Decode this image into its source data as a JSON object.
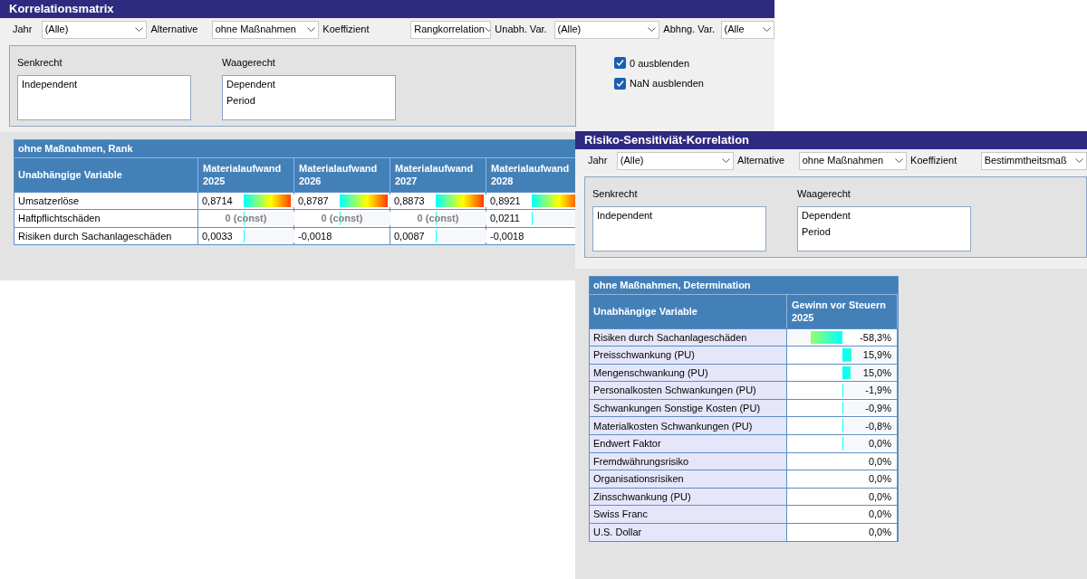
{
  "windows": [
    {
      "title": "Korrelationsmatrix",
      "filters": [
        {
          "label": "Jahr",
          "value": "(Alle)"
        },
        {
          "label": "Alternative",
          "value": "ohne Maßnahmen"
        },
        {
          "label": "Koeffizient",
          "value": "Rangkorrelation"
        },
        {
          "label": "Unabh. Var.",
          "value": "(Alle)"
        },
        {
          "label": "Abhng. Var.",
          "value": "(Alle"
        }
      ],
      "panel": {
        "vertical_label": "Senkrecht",
        "vertical_items": [
          "Independent"
        ],
        "horizontal_label": "Waagerecht",
        "horizontal_items": [
          "Dependent",
          "Period"
        ]
      },
      "checkboxes": [
        {
          "label": "0 ausblenden",
          "checked": true
        },
        {
          "label": "NaN ausblenden",
          "checked": true
        }
      ],
      "table": {
        "caption": "ohne Maßnahmen, Rank",
        "header": "Unabhängige Variable",
        "columns": [
          "Materialaufwand 2025",
          "Materialaufwand 2026",
          "Materialaufwand 2027",
          "Materialaufwand 2028"
        ],
        "rows": [
          {
            "label": "Umsatzerlöse",
            "cells": [
              {
                "text": "0,8714",
                "kind": "value",
                "level": 0.8714
              },
              {
                "text": "0,8787",
                "kind": "value",
                "level": 0.8787
              },
              {
                "text": "0,8873",
                "kind": "value",
                "level": 0.8873
              },
              {
                "text": "0,8921",
                "kind": "value",
                "level": 0.8921
              }
            ]
          },
          {
            "label": "Haftpflichtschäden",
            "cells": [
              {
                "text": "0 (const)",
                "kind": "const",
                "level": 0.001
              },
              {
                "text": "0 (const)",
                "kind": "const",
                "level": 0.001
              },
              {
                "text": "0 (const)",
                "kind": "const",
                "level": 0.001
              },
              {
                "text": "0,0211",
                "kind": "value",
                "level": 0.0211
              }
            ]
          },
          {
            "label": "Risiken durch Sachanlageschäden",
            "cells": [
              {
                "text": "0,0033",
                "kind": "value",
                "level": 0.0033
              },
              {
                "text": "-0,0018",
                "kind": "value"
              },
              {
                "text": "0,0087",
                "kind": "value",
                "level": 0.0087
              },
              {
                "text": "-0,0018",
                "kind": "value"
              }
            ]
          }
        ]
      }
    },
    {
      "title": "Risiko-Sensitiviät-Korrelation",
      "filters": [
        {
          "label": "Jahr",
          "value": "(Alle)"
        },
        {
          "label": "Alternative",
          "value": "ohne Maßnahmen"
        },
        {
          "label": "Koeffizient",
          "value": "Bestimmtheitsmaß"
        }
      ],
      "panel": {
        "vertical_label": "Senkrecht",
        "vertical_items": [
          "Independent"
        ],
        "horizontal_label": "Waagerecht",
        "horizontal_items": [
          "Dependent",
          "Period"
        ]
      },
      "table": {
        "caption": "ohne Maßnahmen, Determination",
        "header": "Unabhängige Variable",
        "columns": [
          "Gewinn vor Steuern 2025"
        ],
        "rows": [
          {
            "label": "Risiken durch Sachanlageschäden",
            "cells": [
              {
                "text": "-58,3%",
                "kind": "signed",
                "level": 0.583,
                "negative": true
              }
            ]
          },
          {
            "label": "Preisschwankung (PU)",
            "cells": [
              {
                "text": "15,9%",
                "kind": "signed",
                "level": 0.159,
                "negative": false
              }
            ]
          },
          {
            "label": "Mengenschwankung (PU)",
            "cells": [
              {
                "text": "15,0%",
                "kind": "signed",
                "level": 0.15,
                "negative": false
              }
            ]
          },
          {
            "label": "Personalkosten Schwankungen (PU)",
            "cells": [
              {
                "text": "-1,9%",
                "kind": "signed",
                "level": 0.019
              }
            ]
          },
          {
            "label": "Schwankungen Sonstige Kosten (PU)",
            "cells": [
              {
                "text": "-0,9%",
                "kind": "signed",
                "level": 0.009
              }
            ]
          },
          {
            "label": "Materialkosten Schwankungen (PU)",
            "cells": [
              {
                "text": "-0,8%",
                "kind": "signed",
                "level": 0.008
              }
            ]
          },
          {
            "label": "Endwert Faktor",
            "cells": [
              {
                "text": "0,0%",
                "kind": "signed",
                "level": 0.001
              }
            ]
          },
          {
            "label": "Fremdwährungsrisiko",
            "cells": [
              {
                "text": "0,0%",
                "kind": "signed"
              }
            ]
          },
          {
            "label": "Organisationsrisiken",
            "cells": [
              {
                "text": "0,0%",
                "kind": "signed"
              }
            ]
          },
          {
            "label": "Zinsschwankung (PU)",
            "cells": [
              {
                "text": "0,0%",
                "kind": "signed"
              }
            ]
          },
          {
            "label": "Swiss Franc",
            "cells": [
              {
                "text": "0,0%",
                "kind": "signed"
              }
            ]
          },
          {
            "label": "U.S. Dollar",
            "cells": [
              {
                "text": "0,0%",
                "kind": "signed"
              }
            ]
          }
        ]
      }
    }
  ]
}
